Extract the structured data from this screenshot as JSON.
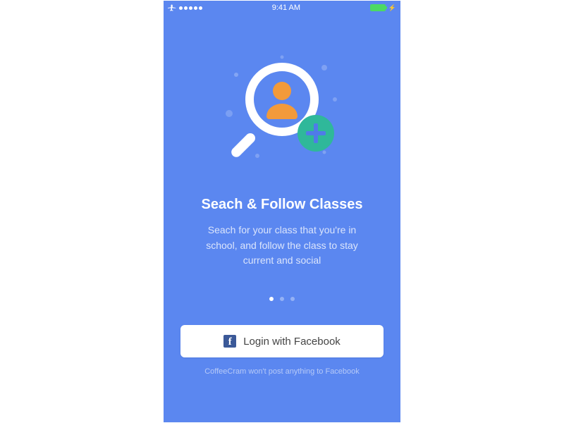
{
  "status": {
    "time": "9:41 AM"
  },
  "onboarding": {
    "title": "Seach & Follow Classes",
    "body": "Seach for your class that you're in school, and follow the class to stay current and social",
    "pageCount": 3,
    "activePage": 0
  },
  "cta": {
    "label": "Login with Facebook"
  },
  "footer": {
    "disclaimer": "CoffeeCram won't post anything to Facebook"
  },
  "illustration": {
    "magnifier": "search-icon",
    "person": "person-icon",
    "addBadge": "plus-icon"
  },
  "colors": {
    "bg": "#5b87f0",
    "accentPerson": "#f29a3a",
    "accentBadge": "#2fb89a",
    "battery": "#4cd964",
    "facebook": "#3b5998"
  }
}
